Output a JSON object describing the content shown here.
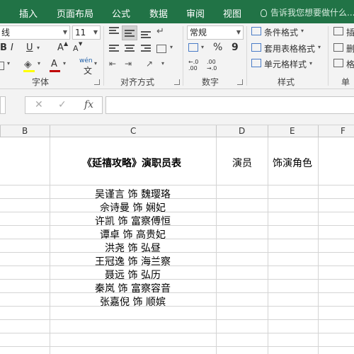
{
  "ribbon_tabs": [
    "插入",
    "页面布局",
    "公式",
    "数据",
    "审阅",
    "视图"
  ],
  "tell_me": "告诉我您想要做什么...",
  "font": {
    "name_fragment": "线",
    "size": "11",
    "bold": "B",
    "italic": "I",
    "underline": "U",
    "grow": "A",
    "shrink": "A",
    "font_color_letter": "A",
    "phonetic": "wén",
    "group_label": "字体"
  },
  "alignment": {
    "group_label": "对齐方式"
  },
  "number": {
    "format": "常规",
    "percent": "%",
    "comma": "9",
    "inc_decimal": "←.0 .00",
    "dec_decimal": ".00 →.0",
    "group_label": "数字"
  },
  "styles": {
    "conditional": "条件格式",
    "table": "套用表格格式",
    "cell": "单元格样式",
    "group_label": "样式"
  },
  "cells_group": {
    "group_label_fragment": "单元",
    "insert_fragment": "插",
    "delete_fragment": "删",
    "format_fragment": "格"
  },
  "formula_bar": {
    "cancel": "✕",
    "enter": "✓",
    "fx": "fx",
    "value": ""
  },
  "columns": [
    "B",
    "C",
    "D",
    "E",
    "F"
  ],
  "sheet": {
    "header_title": "《延禧攻略》演职员表",
    "header_actor": "演员",
    "header_role": "饰演角色",
    "rows": [
      "吴谨言 饰 魏璎珞",
      "佘诗曼 饰 娴妃",
      "许凯 饰 富察傅恒",
      "谭卓 饰 高贵妃",
      "洪尧 饰 弘昼",
      "王冠逸 饰 海兰察",
      "聂远 饰 弘历",
      "秦岚 饰 富察容音",
      "张嘉倪 饰 顺嫔"
    ]
  },
  "colors": {
    "tab_green": "#217346",
    "ribbon_bg": "#f3f3f3",
    "gridline": "#d4d4d4"
  }
}
